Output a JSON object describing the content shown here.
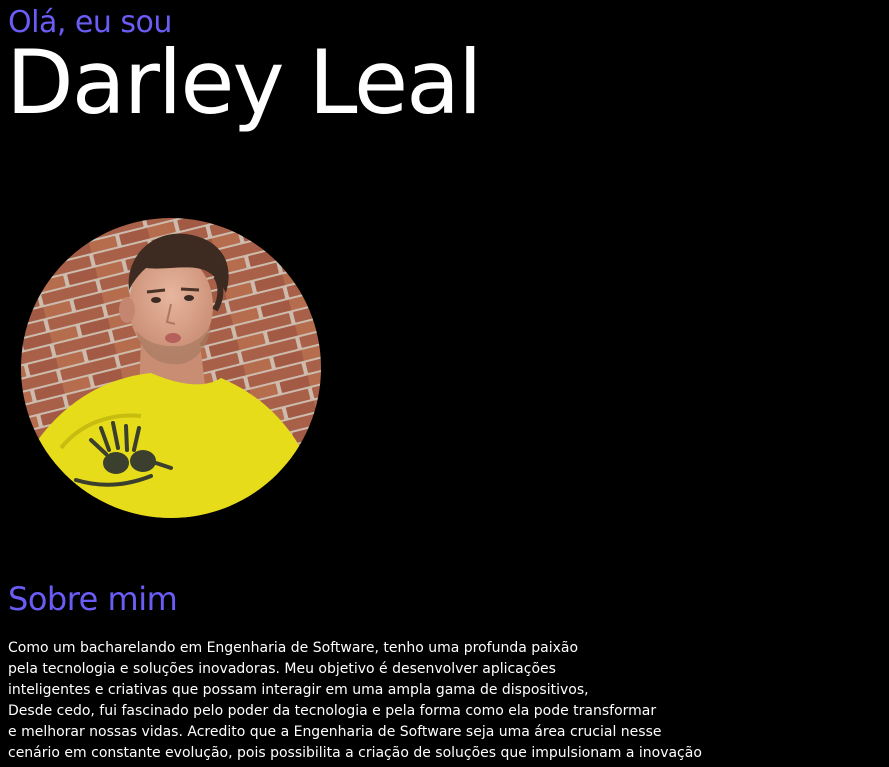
{
  "hero": {
    "greeting": "Olá, eu sou",
    "name": "Darley Leal"
  },
  "profile": {
    "photo_alt": "Foto de Darley Leal"
  },
  "about": {
    "title": "Sobre mim",
    "lines": [
      "Como um bacharelando em Engenharia de Software, tenho uma profunda paixão",
      "pela tecnologia e soluções inovadoras. Meu objetivo é desenvolver aplicações",
      "inteligentes e criativas que possam interagir em uma ampla gama de dispositivos,",
      "Desde cedo, fui fascinado pelo poder da tecnologia e pela forma como ela pode transformar",
      "e melhorar nossas vidas. Acredito que a Engenharia de Software seja uma área crucial nesse",
      "cenário em constante evolução, pois possibilita a criação de soluções que impulsionam a inovação"
    ]
  },
  "colors": {
    "background": "#000000",
    "accent": "#6a5cf5",
    "text": "#ffffff"
  }
}
